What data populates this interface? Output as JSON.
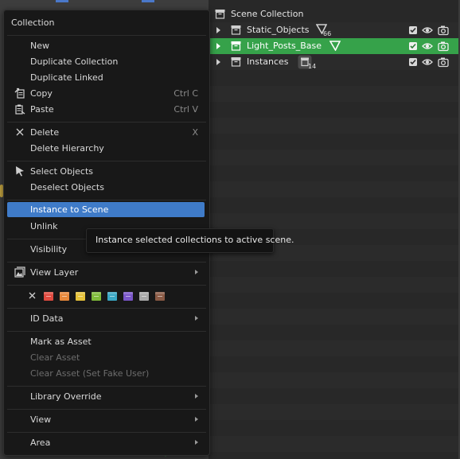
{
  "outliner": {
    "rows": [
      {
        "label": "Scene Collection"
      },
      {
        "label": "Static_Objects",
        "count": "66"
      },
      {
        "label": "Light_Posts_Base"
      },
      {
        "label": "Instances",
        "count": "14"
      }
    ]
  },
  "menu": {
    "title": "Collection",
    "items": {
      "new": "New",
      "duplicate_collection": "Duplicate Collection",
      "duplicate_linked": "Duplicate Linked",
      "copy": "Copy",
      "copy_shortcut": "Ctrl C",
      "paste": "Paste",
      "paste_shortcut": "Ctrl V",
      "delete": "Delete",
      "delete_shortcut": "X",
      "delete_hierarchy": "Delete Hierarchy",
      "select_objects": "Select Objects",
      "deselect_objects": "Deselect Objects",
      "instance_to_scene": "Instance to Scene",
      "unlink": "Unlink",
      "visibility": "Visibility",
      "view_layer": "View Layer",
      "id_data": "ID Data",
      "mark_as_asset": "Mark as Asset",
      "clear_asset": "Clear Asset",
      "clear_asset_fake_user": "Clear Asset (Set Fake User)",
      "library_override": "Library Override",
      "view": "View",
      "area": "Area"
    },
    "color_tags": [
      "#e04a3f",
      "#e8883a",
      "#e6c23a",
      "#7fbb3a",
      "#3aa7c4",
      "#7a56c8",
      "#a9a9a9",
      "#8a5a45"
    ]
  },
  "tooltip": {
    "text": "Instance selected collections to active scene."
  },
  "icons": {
    "collection": "collection-box-icon",
    "filter": "funnel-icon",
    "checkbox": "checkbox-icon",
    "eye": "eye-icon",
    "camera": "camera-icon"
  }
}
